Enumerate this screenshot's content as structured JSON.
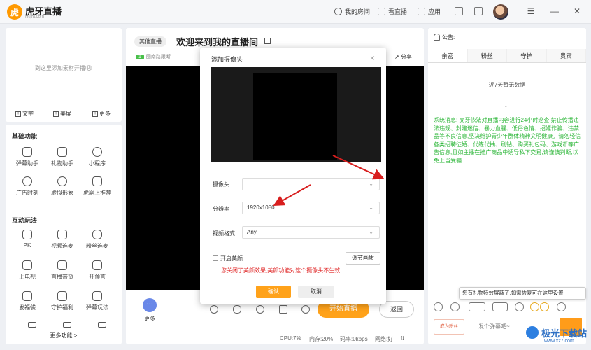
{
  "app": {
    "logo_char": "虎",
    "logo_text": "虎牙直播",
    "logo_sub": "Huya.com"
  },
  "topnav": [
    {
      "label": "我的房间"
    },
    {
      "label": "看直播"
    },
    {
      "label": "应用"
    }
  ],
  "window_controls": {
    "menu": "☰",
    "minimize": "—",
    "close": "✕"
  },
  "left": {
    "add_hint": "到这里添加素材开播吧!",
    "add_buttons": [
      "文字",
      "美屏",
      "更多"
    ],
    "basic_title": "基础功能",
    "basic_tools": [
      "弹幕助手",
      "礼物助手",
      "小程序",
      "广告时刻",
      "虚拟形象",
      "虎嗣上推荐"
    ],
    "interact_title": "互动玩法",
    "interact_tools": [
      "PK",
      "视频连麦",
      "粉丝连麦",
      "上电视",
      "直播带货",
      "开预言",
      "发福袋",
      "守护福利",
      "弹幕玩法"
    ],
    "more_funcs": "更多功能 >"
  },
  "center": {
    "category": "其他直播",
    "room_title": "欢迎来到我的直播间",
    "level": "1",
    "level_text": "图南路跟断",
    "share": "分享",
    "more": "更多",
    "more_glyph": "···",
    "start_live": "开始直播",
    "back": "返回",
    "stats": {
      "cpu": "CPU:7%",
      "mem": "内存:20%",
      "bitrate": "码率:0kbps",
      "network": "网络:好",
      "expand": "⇅"
    }
  },
  "right": {
    "notice_label": "公告:",
    "tabs": [
      "亲密",
      "粉丝",
      "守护",
      "贵宾"
    ],
    "no_data": "近7天暂无数据",
    "chevron": "⌄",
    "system_message": "系统消息: 虎牙依法对直播内容进行24小时巡查,禁止传播违法违规、封建迷信、暴力血腥、低俗色情、招嫖诈骗、违禁品等不良信息,坚决维护青少年群体精神文明健康。请勿轻信各类招聘征婚、代练代抽、刷钻、购买礼包码、游戏币等广告信息,且如主播在推广商品中诱导私下交易,请谨慎判断,以免上当受骗",
    "gift_tip": "您有礼物特效屏蔽了,如需恢复可在这里设置",
    "fan_badge": "成为粉丝",
    "danmu_placeholder": "发个弹幕吧~"
  },
  "modal": {
    "title": "添加摄像头",
    "close": "×",
    "camera_label": "摄像头",
    "camera_value": "",
    "resolution_label": "分辨率",
    "resolution_value": "1920x1080",
    "format_label": "视频格式",
    "format_value": "Any",
    "beauty_label": "开启美颜",
    "adjust": "调节画质",
    "warning": "您关闭了美颜效果,美颜功能对这个摄像头不生效",
    "confirm": "确认",
    "cancel": "取消"
  },
  "watermark": {
    "text": "极光下载站",
    "url": "www.xz7.com"
  },
  "colors": {
    "accent": "#ffa21a",
    "green_text": "#2fb73b",
    "warning": "#e02a2a",
    "arrow": "#d81e1e"
  }
}
